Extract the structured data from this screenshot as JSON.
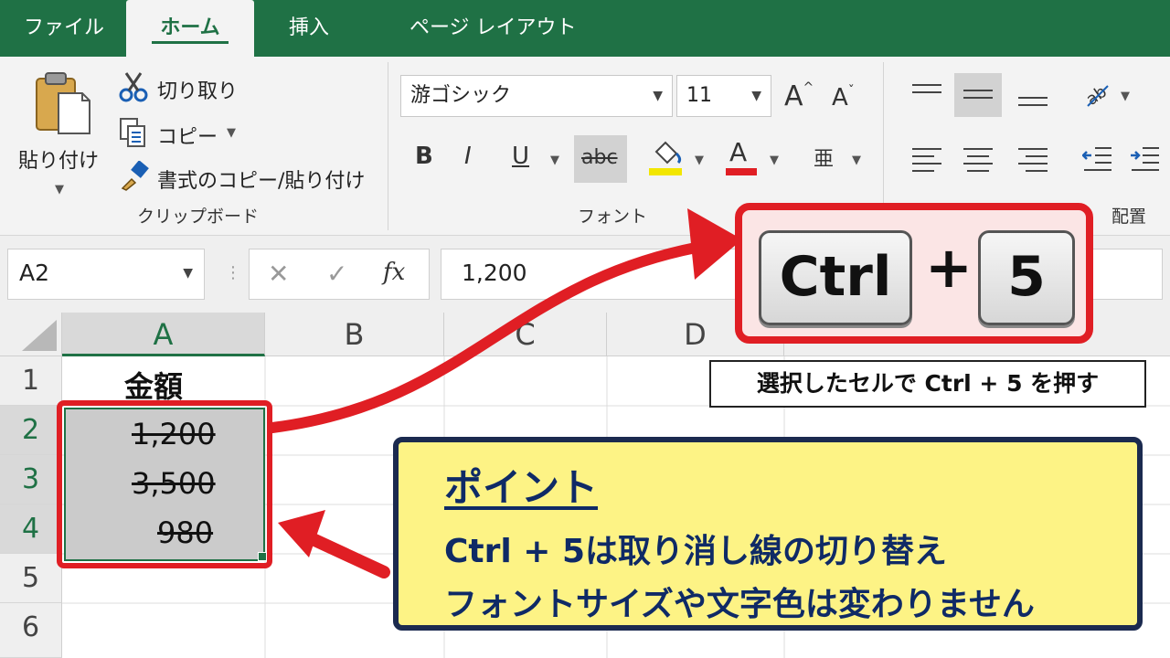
{
  "tabs": [
    {
      "label": "ファイル"
    },
    {
      "label": "ホーム"
    },
    {
      "label": "挿入"
    },
    {
      "label": "ページ レイアウト"
    }
  ],
  "ribbon": {
    "clipboard": {
      "paste_label": "貼り付け",
      "cut_label": "切り取り",
      "copy_label": "コピー",
      "format_painter_label": "書式のコピー/貼り付け",
      "group_label": "クリップボード"
    },
    "font": {
      "font_name": "游ゴシック",
      "font_size": "11",
      "bold": "B",
      "italic": "I",
      "underline": "U",
      "strike": "abc",
      "font_color_glyph": "A",
      "grow_glyph": "A",
      "shrink_glyph": "A",
      "phonetic_glyph": "亜",
      "group_label": "フォント"
    },
    "alignment": {
      "group_label": "配置"
    },
    "colors": {
      "highlight": "#f2e600",
      "font_color": "#e01e24"
    }
  },
  "formula_bar": {
    "name_box": "A2",
    "cancel": "✕",
    "enter": "✓",
    "fx": "fx",
    "value": "1,200"
  },
  "grid": {
    "columns": [
      "A",
      "B",
      "C",
      "D"
    ],
    "rows": [
      "1",
      "2",
      "3",
      "4",
      "5",
      "6"
    ],
    "header_cell": "金額",
    "values": [
      "1,200",
      "3,500",
      "980"
    ]
  },
  "shortcut": {
    "key1": "Ctrl",
    "plus": "+",
    "key2": "5",
    "caption": "選択したセルで Ctrl + 5 を押す"
  },
  "point": {
    "title": "ポイント",
    "line1": "Ctrl + 5は取り消し線の切り替え",
    "line2": "フォントサイズや文字色は変わりません"
  },
  "accent": {
    "excel_green": "#1f7145",
    "callout_red": "#e01e24",
    "point_navy": "#0f2a66",
    "point_yellow": "#fdf385"
  }
}
